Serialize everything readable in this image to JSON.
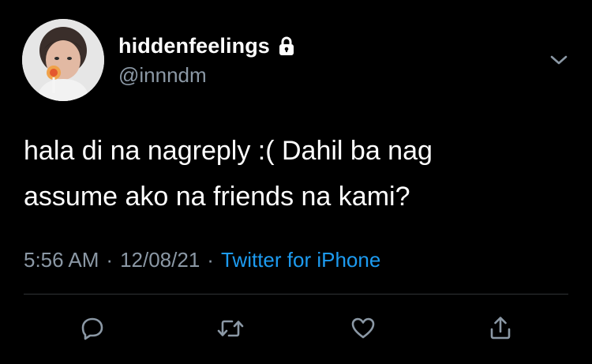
{
  "tweet": {
    "author": {
      "display_name": "hiddenfeelings",
      "handle": "@innndm",
      "protected_icon": "lock-icon",
      "avatar": "avatar-photo"
    },
    "text": "hala di na nagreply :( Dahil ba nag\nassume ako na friends na kami?",
    "meta": {
      "time": "5:56 AM",
      "separator": "·",
      "date": "12/08/21",
      "source": "Twitter for iPhone"
    },
    "more_icon": "chevron-down-icon",
    "actions": [
      "reply-icon",
      "retweet-icon",
      "like-icon",
      "share-icon"
    ]
  },
  "colors": {
    "background": "#000000",
    "text_primary": "#ffffff",
    "text_secondary": "#8b98a5",
    "accent": "#1d9bf0",
    "divider": "#2f3336"
  }
}
